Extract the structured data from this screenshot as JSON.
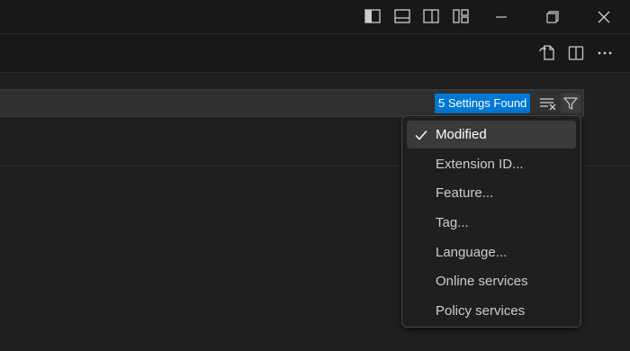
{
  "search": {
    "result_badge": "5 Settings Found"
  },
  "filter_menu": {
    "items": [
      {
        "label": "Modified",
        "checked": true
      },
      {
        "label": "Extension ID...",
        "checked": false
      },
      {
        "label": "Feature...",
        "checked": false
      },
      {
        "label": "Tag...",
        "checked": false
      },
      {
        "label": "Language...",
        "checked": false
      },
      {
        "label": "Online services",
        "checked": false
      },
      {
        "label": "Policy services",
        "checked": false
      }
    ]
  },
  "icons": {
    "title_bar": [
      "toggle-primary-sidebar-icon",
      "toggle-panel-icon",
      "toggle-secondary-sidebar-icon",
      "customize-layout-icon"
    ],
    "window": [
      "minimize-icon",
      "restore-icon",
      "close-icon"
    ],
    "editor_actions": [
      "open-settings-json-icon",
      "split-editor-icon",
      "more-actions-icon"
    ],
    "search": [
      "clear-search-icon",
      "filter-icon"
    ]
  },
  "colors": {
    "accent": "#0078d4",
    "background": "#1f1f1f",
    "titlebar": "#181818",
    "menu_selected": "#3a3a3a"
  }
}
